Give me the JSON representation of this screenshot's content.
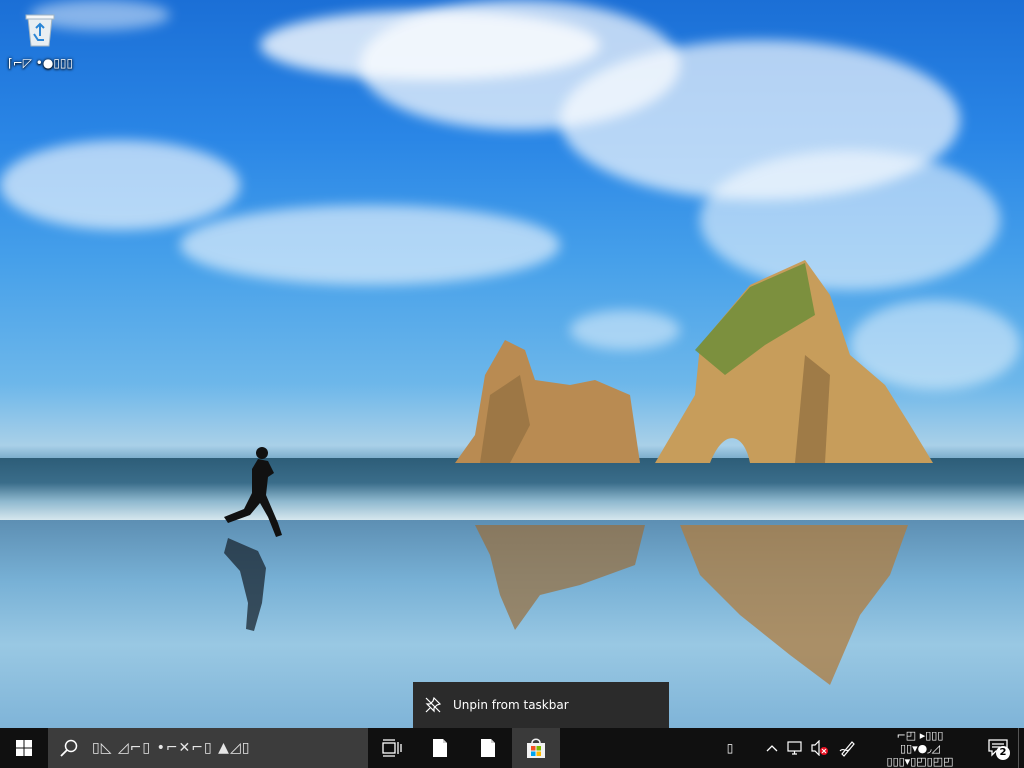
{
  "desktop": {
    "recycle_bin_label": "⌈⌐◸ •●▯▯▯"
  },
  "context_menu": {
    "items": [
      {
        "label": "Unpin from taskbar",
        "icon": "unpin-icon"
      }
    ]
  },
  "taskbar": {
    "search_placeholder": "▯◺ ◿⌐▯ •⌐✕⌐▯ ▲◿▯",
    "pinned_apps": [
      {
        "name": "file-icon"
      },
      {
        "name": "file-icon"
      },
      {
        "name": "microsoft-store-icon",
        "active": true
      }
    ],
    "tray": {
      "input_indicator": "▯",
      "clock_line1": "⌐◰ ▸▯▯▯",
      "clock_line2": "▯▯▾●◞◿",
      "clock_line3": "▯▯▯▾▯◰▯◰◰",
      "notification_count": "2"
    }
  },
  "colors": {
    "taskbar": "#101010",
    "search_box": "#3c3c3c",
    "context_menu": "#2b2b2b",
    "windows_logo": "#ffffff"
  }
}
